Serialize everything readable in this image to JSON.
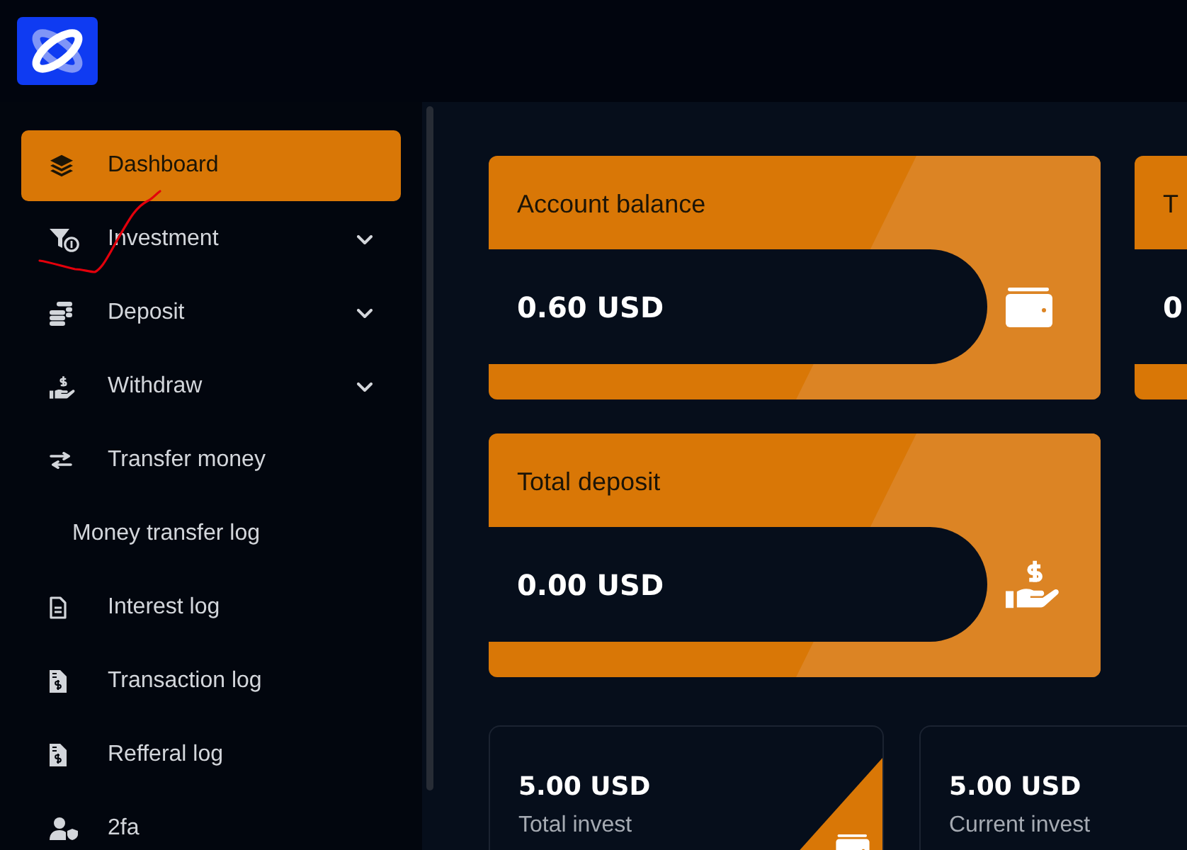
{
  "sidebar": {
    "items": [
      {
        "label": "Dashboard",
        "kind": "link",
        "selected": true
      },
      {
        "label": "Investment",
        "kind": "dropdown",
        "selected": false,
        "expanded": false
      },
      {
        "label": "Deposit",
        "kind": "dropdown",
        "selected": false,
        "expanded": false
      },
      {
        "label": "Withdraw",
        "kind": "dropdown",
        "selected": false,
        "expanded": false
      },
      {
        "label": "Transfer money",
        "kind": "link",
        "selected": false
      },
      {
        "label": "Money transfer log",
        "kind": "sublink",
        "selected": false
      },
      {
        "label": "Interest log",
        "kind": "link",
        "selected": false
      },
      {
        "label": "Transaction log",
        "kind": "link",
        "selected": false
      },
      {
        "label": "Refferal log",
        "kind": "link",
        "selected": false
      },
      {
        "label": "2fa",
        "kind": "link",
        "selected": false
      }
    ]
  },
  "balance_cards": [
    {
      "title": "Account balance",
      "value": "0.60 USD"
    },
    {
      "title": "T",
      "value": "0"
    },
    {
      "title": "Total deposit",
      "value": "0.00 USD"
    }
  ],
  "invest_cards": [
    {
      "value": "5.00 USD",
      "label": "Total invest"
    },
    {
      "value": "5.00 USD",
      "label": "Current invest"
    }
  ]
}
